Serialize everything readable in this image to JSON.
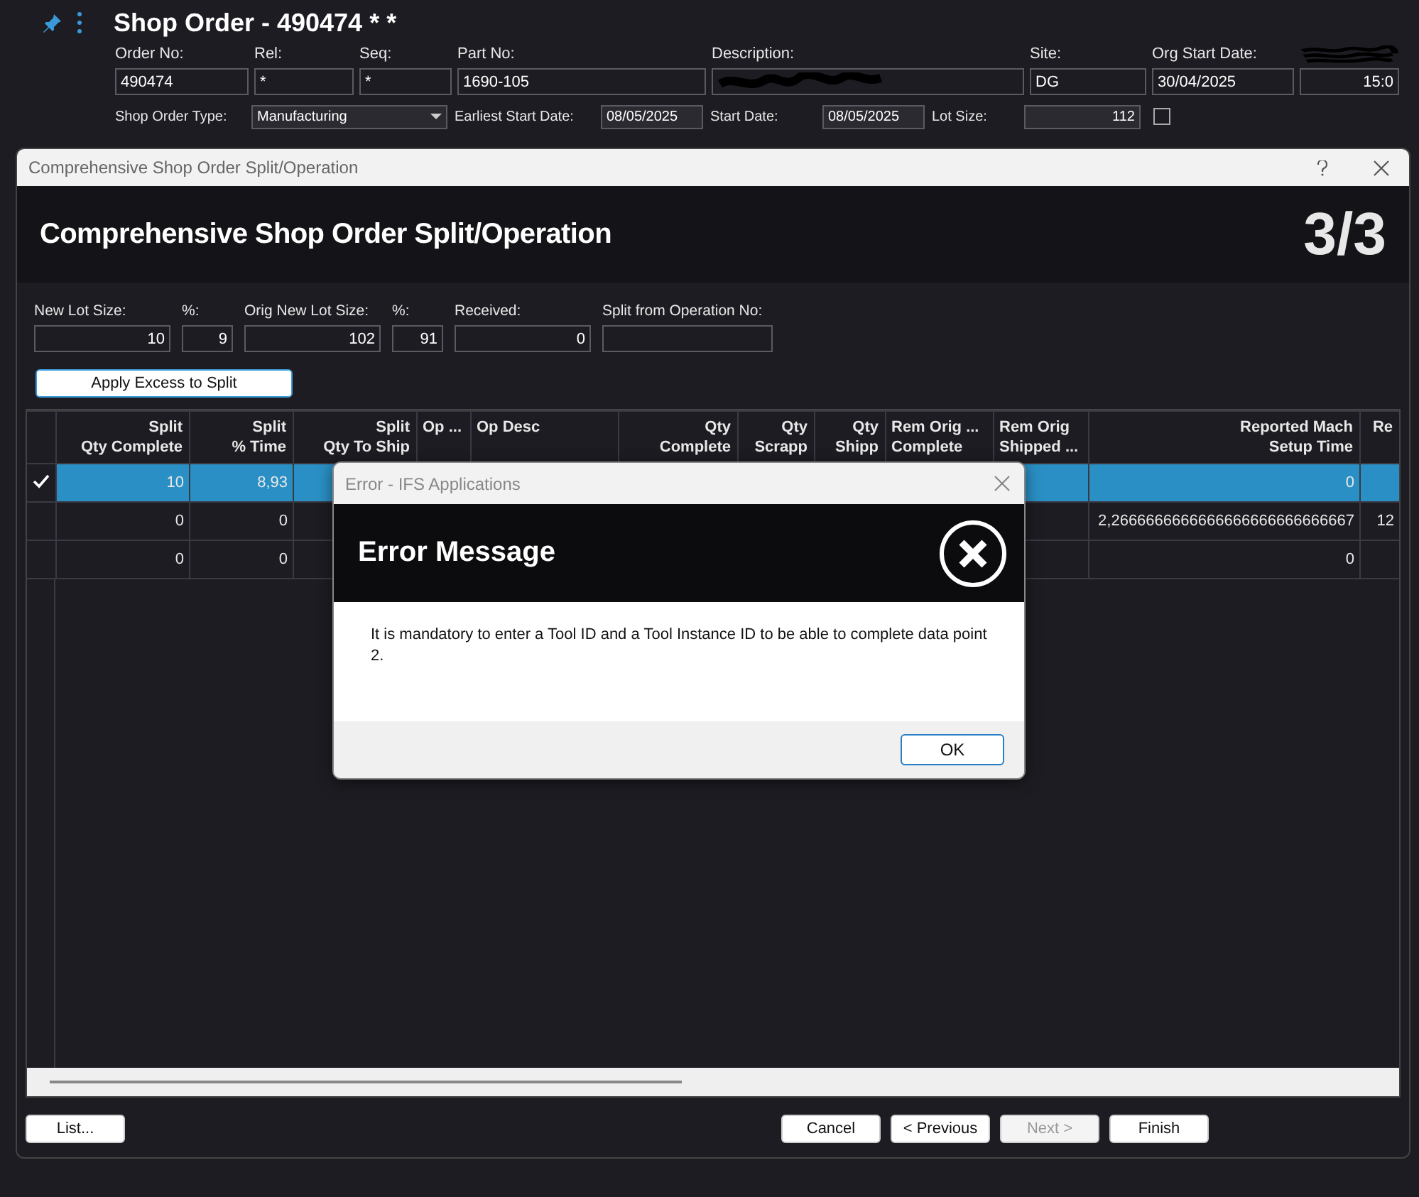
{
  "page": {
    "title": "Shop Order - 490474 * *",
    "fields": [
      {
        "kind": "text",
        "label": "Order No:",
        "value": "490474"
      },
      {
        "kind": "text",
        "label": "Rel:",
        "value": "*"
      },
      {
        "kind": "text",
        "label": "Seq:",
        "value": "*"
      },
      {
        "kind": "text",
        "label": "Part No:",
        "value": "1690-105"
      },
      {
        "kind": "redacted",
        "label": "Description:"
      },
      {
        "kind": "text",
        "label": "Site:",
        "value": "DG"
      },
      {
        "kind": "text",
        "label": "Org Start Date:",
        "value": "30/04/2025"
      },
      {
        "kind": "redacted_label",
        "value": "15:0"
      }
    ],
    "fields_row2": [
      {
        "kind": "dropdown",
        "label": "Shop Order Type:",
        "value": "Manufacturing"
      },
      {
        "kind": "text",
        "label": "Earliest Start Date:",
        "value": "08/05/2025"
      },
      {
        "kind": "text",
        "label": "Start Date:",
        "value": "08/05/2025"
      },
      {
        "kind": "number",
        "label": "Lot Size:",
        "value": "112"
      },
      {
        "kind": "checkbox",
        "checked": false
      }
    ]
  },
  "wizard": {
    "window_title": "Comprehensive Shop Order Split/Operation",
    "heading": "Comprehensive Shop Order Split/Operation",
    "step": "3/3",
    "fields": [
      {
        "label": "New Lot Size:",
        "value": "10"
      },
      {
        "label": "%:",
        "value": "9"
      },
      {
        "label": "Orig New Lot Size:",
        "value": "102"
      },
      {
        "label": "%:",
        "value": "91"
      },
      {
        "label": "Received:",
        "value": "0"
      },
      {
        "label": "Split from Operation No:"
      }
    ],
    "apply_button": "Apply Excess to Split",
    "table": {
      "columns": [
        {
          "line_1": "Split",
          "line_2": "Qty Complete"
        },
        {
          "line_1": "Split",
          "line_2": "% Time"
        },
        {
          "line_1": "Split",
          "line_2": "Qty To Ship"
        },
        {
          "line_1": "Op ..."
        },
        {
          "line_1": "Op Desc"
        },
        {
          "line_1": "Qty",
          "line_2": "Complete"
        },
        {
          "line_1": "Qty",
          "line_2": "Scrapp"
        },
        {
          "line_1": "Qty",
          "line_2": "Shipp"
        },
        {
          "line_1": "Rem Orig ...",
          "line_2": "Complete"
        },
        {
          "line_1": "Rem Orig",
          "line_2": "Shipped ..."
        },
        {
          "line_1": "Reported Mach",
          "line_2": "Setup Time"
        },
        {
          "line_1": "Re"
        }
      ],
      "rows": [
        {
          "selected": true,
          "cells": [
            "10",
            "8,93",
            null,
            null,
            null,
            null,
            null,
            null,
            null,
            null,
            "0",
            null
          ]
        },
        {
          "selected": false,
          "cells": [
            "0",
            "0",
            null,
            null,
            null,
            null,
            null,
            null,
            null,
            null,
            "2,2666666666666666666666666667",
            "12"
          ]
        },
        {
          "selected": false,
          "cells": [
            "0",
            "0",
            null,
            null,
            null,
            null,
            null,
            null,
            null,
            null,
            "0",
            null
          ]
        }
      ]
    },
    "buttons": [
      {
        "kind": "left",
        "label": "List...",
        "disabled": false
      },
      {
        "kind": "right",
        "label": "Cancel",
        "disabled": false
      },
      {
        "kind": "right",
        "label": "< Previous",
        "disabled": false
      },
      {
        "kind": "right",
        "label": "Next >",
        "disabled": true
      },
      {
        "kind": "right",
        "label": "Finish",
        "disabled": false
      }
    ]
  },
  "error_dialog": {
    "window_title": "Error - IFS Applications",
    "heading": "Error Message",
    "message": "It is mandatory to enter a Tool ID and a Tool Instance ID to be able to complete data point 2.",
    "button": "OK"
  }
}
